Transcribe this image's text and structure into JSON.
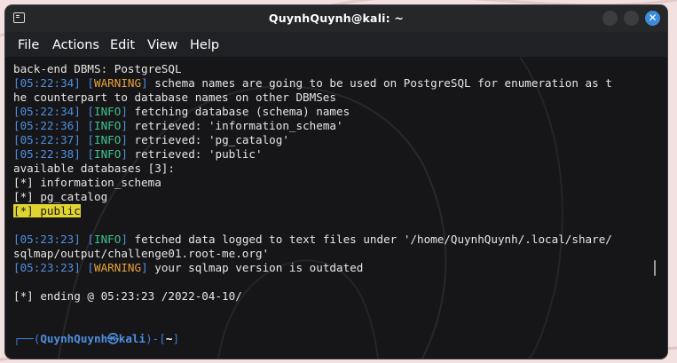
{
  "window": {
    "title": "QuynhQuynh@kali: ~",
    "app_icon": "terminal-icon",
    "controls": {
      "minimize_icon": "minimize-icon",
      "maximize_icon": "maximize-icon",
      "close_icon": "close-icon",
      "close_glyph": "✕"
    }
  },
  "menu": [
    "File",
    "Actions",
    "Edit",
    "View",
    "Help"
  ],
  "output": [
    {
      "segments": [
        {
          "t": "back-end DBMS: PostgreSQL"
        }
      ]
    },
    {
      "segments": [
        {
          "t": "[",
          "c": "ts"
        },
        {
          "t": "05:22:34",
          "c": "ts"
        },
        {
          "t": "] [",
          "c": "ts"
        },
        {
          "t": "WARNING",
          "c": "warn"
        },
        {
          "t": "]",
          "c": "ts"
        },
        {
          "t": " schema names are going to be used on PostgreSQL for enumeration as t"
        }
      ]
    },
    {
      "segments": [
        {
          "t": "he counterpart to database names on other DBMSes"
        }
      ]
    },
    {
      "segments": [
        {
          "t": "[",
          "c": "ts"
        },
        {
          "t": "05:22:34",
          "c": "ts"
        },
        {
          "t": "] [",
          "c": "ts"
        },
        {
          "t": "INFO",
          "c": "info"
        },
        {
          "t": "]",
          "c": "ts"
        },
        {
          "t": " fetching database (schema) names"
        }
      ]
    },
    {
      "segments": [
        {
          "t": "[",
          "c": "ts"
        },
        {
          "t": "05:22:36",
          "c": "ts"
        },
        {
          "t": "] [",
          "c": "ts"
        },
        {
          "t": "INFO",
          "c": "info"
        },
        {
          "t": "]",
          "c": "ts"
        },
        {
          "t": " retrieved: 'information_schema'"
        }
      ]
    },
    {
      "segments": [
        {
          "t": "[",
          "c": "ts"
        },
        {
          "t": "05:22:37",
          "c": "ts"
        },
        {
          "t": "] [",
          "c": "ts"
        },
        {
          "t": "INFO",
          "c": "info"
        },
        {
          "t": "]",
          "c": "ts"
        },
        {
          "t": " retrieved: 'pg_catalog'"
        }
      ]
    },
    {
      "segments": [
        {
          "t": "[",
          "c": "ts"
        },
        {
          "t": "05:22:38",
          "c": "ts"
        },
        {
          "t": "] [",
          "c": "ts"
        },
        {
          "t": "INFO",
          "c": "info"
        },
        {
          "t": "]",
          "c": "ts"
        },
        {
          "t": " retrieved: 'public'"
        }
      ]
    },
    {
      "segments": [
        {
          "t": "available databases [3]:"
        }
      ]
    },
    {
      "segments": [
        {
          "t": "[*] information_schema"
        }
      ]
    },
    {
      "segments": [
        {
          "t": "[*] pg_catalog"
        }
      ]
    },
    {
      "segments": [
        {
          "t": "[*] public",
          "c": "hl"
        }
      ]
    },
    {
      "segments": [
        {
          "t": ""
        }
      ]
    },
    {
      "segments": [
        {
          "t": "[",
          "c": "ts"
        },
        {
          "t": "05:23:23",
          "c": "ts"
        },
        {
          "t": "] [",
          "c": "ts"
        },
        {
          "t": "INFO",
          "c": "info"
        },
        {
          "t": "]",
          "c": "ts"
        },
        {
          "t": " fetched data logged to text files under '/home/QuynhQuynh/.local/share/"
        }
      ]
    },
    {
      "segments": [
        {
          "t": "sqlmap/output/challenge01.root-me.org'"
        }
      ]
    },
    {
      "segments": [
        {
          "t": "[",
          "c": "ts"
        },
        {
          "t": "05:23:23",
          "c": "ts"
        },
        {
          "t": "] [",
          "c": "ts"
        },
        {
          "t": "WARNING",
          "c": "warn"
        },
        {
          "t": "]",
          "c": "ts"
        },
        {
          "t": " your sqlmap version is outdated"
        }
      ]
    },
    {
      "segments": [
        {
          "t": ""
        }
      ]
    },
    {
      "segments": [
        {
          "t": "[*] ending @ 05:23:23 /2022-04-10/"
        }
      ]
    },
    {
      "segments": [
        {
          "t": ""
        }
      ]
    },
    {
      "segments": [
        {
          "t": ""
        }
      ]
    },
    {
      "segments": [
        {
          "t": "┌──(",
          "c": "prompt-frame"
        },
        {
          "t": "QuynhQuynh㉿kali",
          "c": "prompt-user"
        },
        {
          "t": ")-[",
          "c": "prompt-frame"
        },
        {
          "t": "~",
          "c": "prompt-path"
        },
        {
          "t": "]",
          "c": "prompt-frame"
        }
      ]
    }
  ],
  "colors": {
    "timestamp": "#4f8fe0",
    "warning": "#e8a33c",
    "info": "#3fc28f",
    "highlight": "#e0d430",
    "close_button": "#3d8bd8"
  }
}
